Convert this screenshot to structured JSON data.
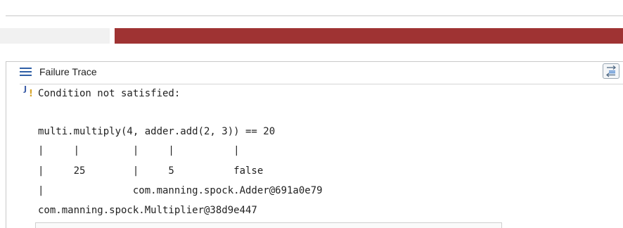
{
  "panel": {
    "title": "Failure Trace",
    "title_icon": "list-icon",
    "compare_icon": "compare-icon",
    "progress_color": "#9f3333"
  },
  "trace": {
    "message_icon": "junit-failure-icon",
    "lines": [
      "Condition not satisfied:",
      "",
      "multi.multiply(4, adder.add(2, 3)) == 20",
      "|     |         |     |          |",
      "|     25        |     5          false",
      "|               com.manning.spock.Adder@691a0e79",
      "com.manning.spock.Multiplier@38d9e447"
    ]
  }
}
